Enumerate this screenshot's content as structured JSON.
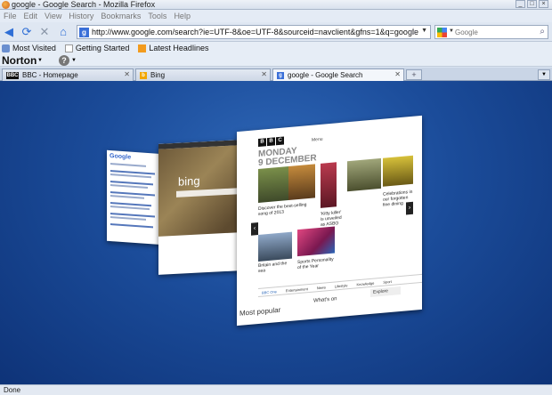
{
  "window": {
    "title": "google - Google Search - Mozilla Firefox",
    "controls": [
      "_",
      "□",
      "×"
    ]
  },
  "menu": [
    "File",
    "Edit",
    "View",
    "History",
    "Bookmarks",
    "Tools",
    "Help"
  ],
  "navigation": {
    "url": "http://www.google.com/search?ie=UTF-8&oe=UTF-8&sourceid=navclient&gfns=1&q=google",
    "search_placeholder": "Google"
  },
  "bookmarks": [
    {
      "label": "Most Visited",
      "icon": "bookmark-star-icon"
    },
    {
      "label": "Getting Started",
      "icon": "page-icon"
    },
    {
      "label": "Latest Headlines",
      "icon": "rss-feed-icon"
    }
  ],
  "norton": {
    "label": "Norton"
  },
  "tabs": [
    {
      "label": "BBC - Homepage",
      "favicon": "BBC",
      "favicon_color": "#111111",
      "active": false
    },
    {
      "label": "Bing",
      "favicon": "b",
      "favicon_color": "#f2a600",
      "active": false
    },
    {
      "label": "google - Google Search",
      "favicon": "g",
      "favicon_color": "#3a6fd8",
      "active": true
    }
  ],
  "preview": {
    "google": {
      "logo": "Google"
    },
    "bing": {
      "logo": "bing"
    },
    "bbc": {
      "logo": [
        "B",
        "B",
        "C"
      ],
      "nav": "Menu",
      "date_line1": "MONDAY",
      "date_line2": "9 DECEMBER",
      "captions": [
        "Discover the best-selling song of 2013",
        "'Kitty killer' is unveiled as ASBO",
        "Celebrations in our forgotten fine dining",
        "Britain and the sea",
        "Sports Personality of the Year"
      ],
      "footer_tabs": [
        "BBC One",
        "Entertainment",
        "News",
        "Lifestyle",
        "Knowledge",
        "Sport"
      ],
      "most_popular": "Most popular",
      "whats_on": "What's on",
      "explore": "Explore"
    }
  },
  "status": {
    "text": "Done"
  },
  "colors": {
    "content_bg": "#1b4c9a",
    "chrome": "#dfe7f2"
  }
}
